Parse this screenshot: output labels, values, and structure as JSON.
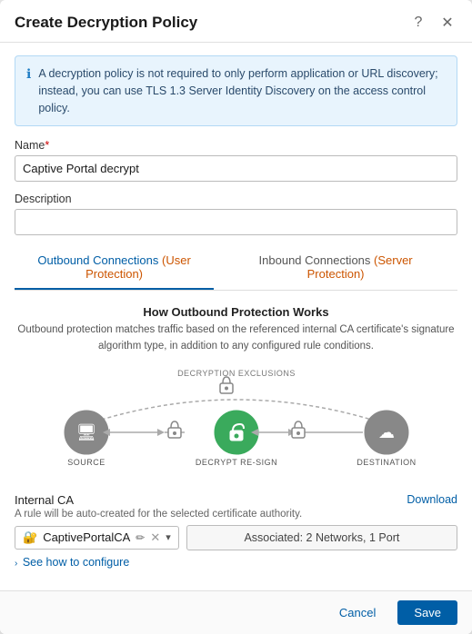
{
  "modal": {
    "title": "Create Decryption Policy"
  },
  "header": {
    "help_icon": "?",
    "close_icon": "✕"
  },
  "info_banner": {
    "text": "A decryption policy is not required to only perform application or URL discovery; instead, you can use TLS 1.3 Server Identity Discovery on the access control policy."
  },
  "form": {
    "name_label": "Name",
    "name_required": "*",
    "name_value": "Captive Portal decrypt",
    "description_label": "Description",
    "description_value": ""
  },
  "tabs": [
    {
      "id": "outbound",
      "label": "Outbound Connections",
      "sub": "(User Protection)",
      "active": true
    },
    {
      "id": "inbound",
      "label": "Inbound Connections",
      "sub": "(Server Protection)",
      "active": false
    }
  ],
  "diagram": {
    "title": "How Outbound Protection Works",
    "description": "Outbound protection matches traffic based on the referenced internal CA certificate's signature algorithm type, in addition to any configured rule conditions.",
    "exclusions_label": "DECRYPTION EXCLUSIONS",
    "source_label": "SOURCE",
    "decrypt_label": "DECRYPT RE-SIGN",
    "destination_label": "DESTINATION"
  },
  "ca_section": {
    "title": "Internal CA",
    "download_label": "Download",
    "subtitle": "A rule will be auto-created for the selected certificate authority.",
    "selected_ca": "CaptivePortalCA",
    "associated_text": "Associated: 2 Networks, 1 Port",
    "see_how_label": "See how to configure"
  },
  "footer": {
    "cancel_label": "Cancel",
    "save_label": "Save"
  }
}
